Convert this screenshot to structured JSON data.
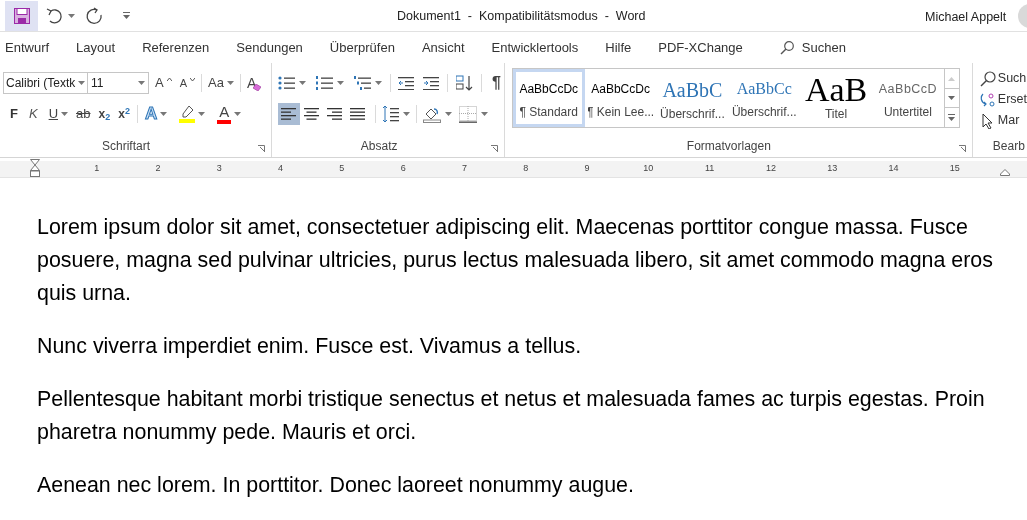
{
  "title_bar": {
    "title": "Dokument1  -  Kompatibilitätsmodus  -  Word",
    "user": "Michael Appelt"
  },
  "tabs": [
    {
      "label": "Entwurf",
      "selected": false
    },
    {
      "label": "Layout",
      "selected": false
    },
    {
      "label": "Referenzen",
      "selected": false
    },
    {
      "label": "Sendungen",
      "selected": false
    },
    {
      "label": "Überprüfen",
      "selected": false
    },
    {
      "label": "Ansicht",
      "selected": false
    },
    {
      "label": "Entwicklertools",
      "selected": false
    },
    {
      "label": "Hilfe",
      "selected": false
    },
    {
      "label": "PDF-XChange",
      "selected": false
    }
  ],
  "search": {
    "label": "Suchen"
  },
  "font_group": {
    "label": "Schriftart",
    "font": "Calibri (Textk",
    "size": "11",
    "grow": "A",
    "shrink": "A",
    "change_case": "Aa",
    "clear_formatting": "A",
    "bold": "F",
    "italic": "K",
    "underline": "U",
    "strikethrough": "ab",
    "subscript": "x$_{2}$",
    "superscript": "x$^{2}$",
    "text_effects": "A",
    "font_color": "A"
  },
  "paragraph_group": {
    "label": "Absatz",
    "show_marks": "¶",
    "alignments": [
      {
        "selected": true
      },
      {
        "selected": false
      },
      {
        "selected": false
      },
      {
        "selected": false
      }
    ]
  },
  "styles_group": {
    "label": "Formatvorlagen",
    "styles": [
      {
        "kind": "normal",
        "preview": "AaBbCcDc",
        "label": "¶ Standard",
        "selected": true
      },
      {
        "kind": "no_spacing",
        "preview": "AaBbCcDc",
        "label": "¶ Kein Lee...",
        "selected": false
      },
      {
        "kind": "heading1",
        "preview": "AaBbC",
        "label": "Überschrif...",
        "selected": false
      },
      {
        "kind": "heading2",
        "preview": "AaBbCc",
        "label": "Überschrif...",
        "selected": false
      },
      {
        "kind": "title",
        "preview": "AaB",
        "label": "Titel",
        "selected": false
      },
      {
        "kind": "subtitle",
        "preview": "AaBbCcD",
        "label": "Untertitel",
        "selected": false
      }
    ]
  },
  "editing_group": {
    "label": "Bearb",
    "items": [
      {
        "label": "Such"
      },
      {
        "label": "Erset"
      },
      {
        "label": "Mar"
      }
    ]
  },
  "ruler": [
    "1",
    "2",
    "3",
    "4",
    "5",
    "6",
    "7",
    "8",
    "9",
    "10",
    "11",
    "12",
    "13",
    "14",
    "15"
  ],
  "paragraphs": [
    "Lorem ipsum dolor sit amet, consectetuer adipiscing elit. Maecenas porttitor congue massa. Fusce posuere, magna sed pulvinar ultricies, purus lectus malesuada libero, sit amet commodo magna eros quis urna.",
    "Nunc viverra imperdiet enim. Fusce est. Vivamus a tellus.",
    "Pellentesque habitant morbi tristique senectus et netus et malesuada fames ac turpis egestas. Proin pharetra nonummy pede. Mauris et orci.",
    "Aenean nec lorem. In porttitor. Donec laoreet nonummy augue."
  ]
}
